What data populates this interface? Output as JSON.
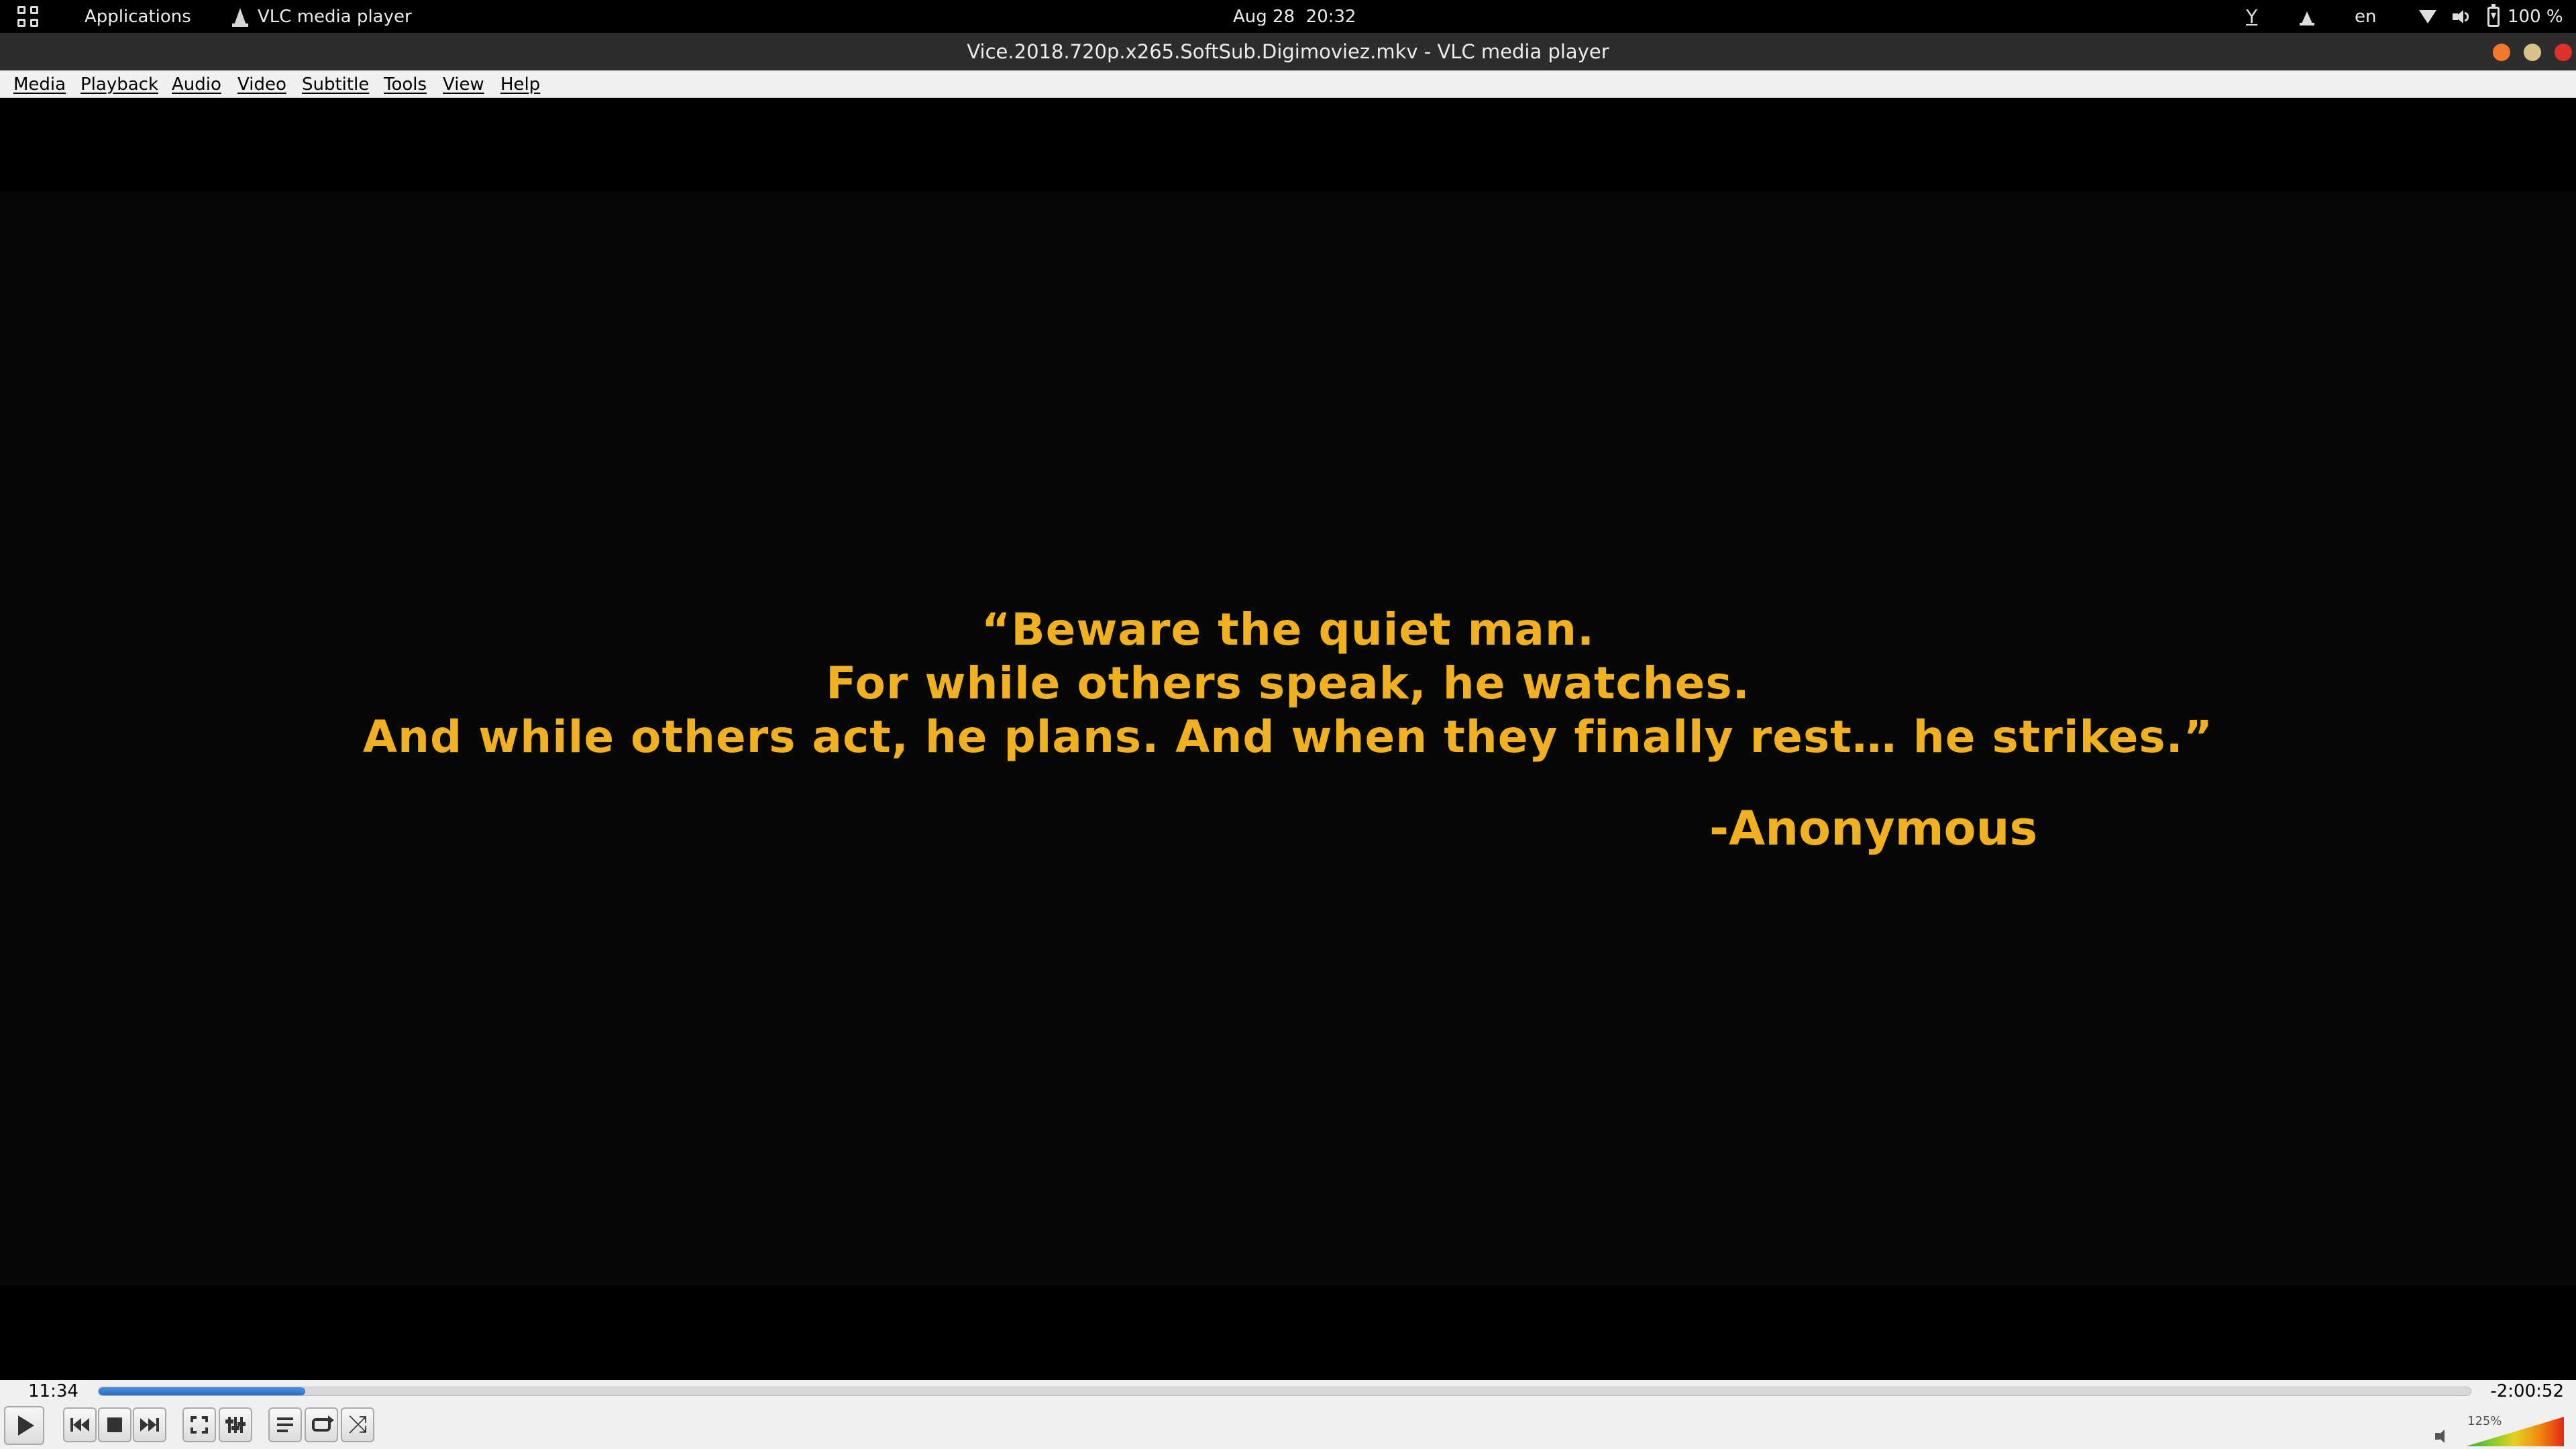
{
  "topbar": {
    "activities_icon": "apps-grid-icon",
    "applications_label": "Applications",
    "app_name": "VLC media player",
    "clock": "Aug 28  20:32",
    "indicator_y": "Y",
    "language": "en",
    "battery": "100 %"
  },
  "window": {
    "title": "Vice.2018.720p.x265.SoftSub.Digimoviez.mkv - VLC media player",
    "buttons": {
      "minimize_color": "#f4782c",
      "maximize_color": "#d9c28a",
      "close_color": "#e0302a"
    }
  },
  "menu": {
    "items": [
      {
        "label": "Media"
      },
      {
        "label": "Playback"
      },
      {
        "label": "Audio"
      },
      {
        "label": "Video"
      },
      {
        "label": "Subtitle"
      },
      {
        "label": "Tools"
      },
      {
        "label": "View"
      },
      {
        "label": "Help"
      }
    ]
  },
  "video": {
    "quote_lines": [
      "“Beware the quiet man.",
      "For while others speak, he watches.",
      "And while others act, he plans. And when they finally rest… he strikes.”"
    ],
    "attribution": "-Anonymous",
    "text_color": "#f0b020"
  },
  "playback": {
    "elapsed": "11:34",
    "remaining": "-2:00:52",
    "progress_fraction": 0.087,
    "accent": "#2a6cc8"
  },
  "controls": {
    "buttons": [
      "play-icon",
      "previous-icon",
      "stop-icon",
      "next-icon",
      "fullscreen-icon",
      "extended-settings-icon",
      "playlist-icon",
      "loop-icon",
      "shuffle-icon"
    ]
  },
  "volume": {
    "label": "125%",
    "level_fraction": 1.0
  }
}
